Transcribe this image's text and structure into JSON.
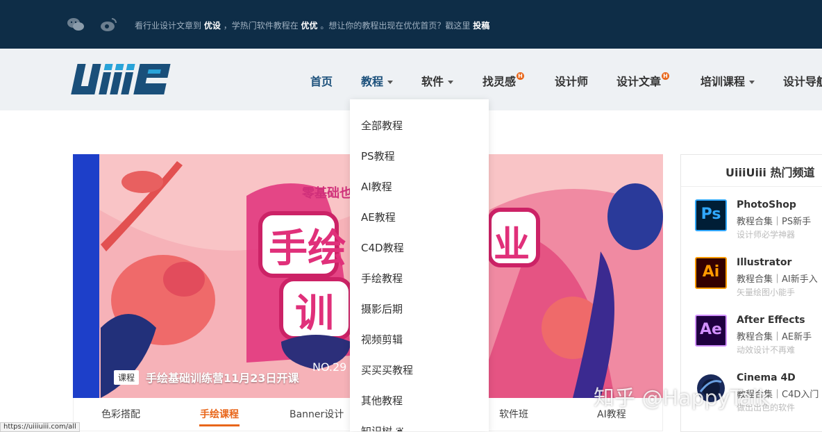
{
  "topbar": {
    "notice_1": "看行业设计文章到",
    "notice_2": "优设",
    "notice_3": "，学热门软件教程在",
    "notice_4": "优优",
    "notice_5": "。想让你的教程出现在优优首页？戳这里",
    "notice_6": "投稿",
    "icons": [
      "wechat-icon",
      "weibo-icon"
    ]
  },
  "header": {
    "logo_text": "Uiiiuiii",
    "nav": [
      {
        "label": "首页"
      },
      {
        "label": "教程"
      },
      {
        "label": "软件"
      },
      {
        "label": "找灵感"
      },
      {
        "label": "设计师"
      },
      {
        "label": "设计文章"
      },
      {
        "label": "培训课程"
      },
      {
        "label": "设计导航"
      }
    ],
    "hot_badge": "H"
  },
  "dropdown": {
    "items": [
      "全部教程",
      "PS教程",
      "AI教程",
      "AE教程",
      "C4D教程",
      "手绘教程",
      "摄影后期",
      "视频剪辑",
      "买买买教程",
      "其他教程",
      "知识树"
    ]
  },
  "banner": {
    "tag": "课程",
    "title": "手绘基础训练营11月23日开课",
    "art_text_top": "零基础也",
    "art_text_main_1": "手绘",
    "art_text_main_2": "训",
    "art_text_right": "业",
    "art_issue": "NO.29"
  },
  "tabs": [
    "色彩搭配",
    "手绘课程",
    "Banner设计",
    "软件班",
    "AI教程"
  ],
  "sidebar": {
    "title": "UiiiUiii 热门频道",
    "apps": [
      {
        "name": "PhotoShop",
        "line": "教程合集｜PS新手",
        "sub": "设计师必学神器",
        "abbr": "Ps",
        "color": "#31a8ff",
        "bg": "#001e36"
      },
      {
        "name": "Illustrator",
        "line": "教程合集｜AI新手入",
        "sub": "矢量绘图小能手",
        "abbr": "Ai",
        "color": "#ff9a00",
        "bg": "#330000"
      },
      {
        "name": "After Effects",
        "line": "教程合集｜AE新手",
        "sub": "动效设计不再难",
        "abbr": "Ae",
        "color": "#d291ff",
        "bg": "#1f0040"
      },
      {
        "name": "Cinema 4D",
        "line": "教程合集｜C4D入门",
        "sub": "做出出色的软件",
        "abbr": "",
        "color": "#ffffff",
        "bg": "#ffffff"
      }
    ]
  },
  "watermark": "知乎 @HappyTalk",
  "status_url": "https://uiiiuiii.com/all"
}
